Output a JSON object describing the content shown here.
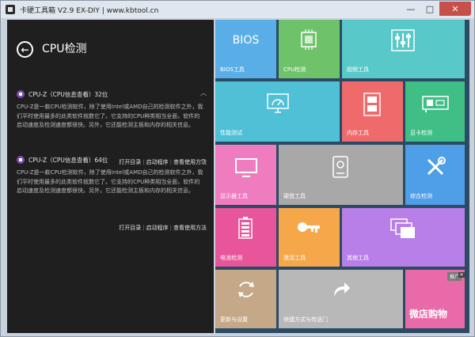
{
  "window": {
    "title": "卡硬工具箱 V2.9  EX-DIY  |  www.kbtool.cn",
    "controls": {
      "minimize": "—",
      "maximize": "□",
      "close": "✕"
    }
  },
  "left": {
    "back_icon": "arrow-left-icon",
    "page_title": "CPU检测",
    "items": [
      {
        "name": "CPU-Z（CPU信息查看）32位",
        "desc": "CPU-Z是一款CPU检测软件，除了使用Intel或AMD自己的检测软件之外，我们平时使用最多的此类软件就数它了。它支持的CPU种类相当全面，软件的启动速度及检测速度都很快。另外，它还能检测主板和内存的相关信息。",
        "links": [
          "打开目录",
          "启动程序",
          "查看使用方法"
        ]
      },
      {
        "name": "CPU-Z（CPU信息查看）64位",
        "desc": "CPU-Z是一款CPU检测软件，除了使用Intel或AMD自己的检测软件之外，我们平时使用最多的此类软件就数它了。它支持的CPU种类相当全面，软件的启动速度及检测速度都很快。另外，它还能检测主板和内存的相关信息。",
        "links": [
          "打开目录",
          "启动程序",
          "查看使用方法"
        ]
      }
    ]
  },
  "tiles": {
    "bios": {
      "label": "BIOS工具",
      "icon_text": "BIOS",
      "color": "#5aaee8"
    },
    "cpu": {
      "label": "CPU检测",
      "color": "#6ec36a"
    },
    "super": {
      "label": "超频工具",
      "color": "#58c8c8"
    },
    "perf": {
      "label": "性能测试",
      "color": "#4fc0d6"
    },
    "memory": {
      "label": "内存工具",
      "color": "#ef6b6b"
    },
    "gpu": {
      "label": "显卡检测",
      "color": "#3fbf86"
    },
    "display": {
      "label": "显示器工具",
      "color": "#f07cc0"
    },
    "disk": {
      "label": "硬盘工具",
      "color": "#a8a8a8"
    },
    "diag": {
      "label": "综合检测",
      "color": "#4e9ee8"
    },
    "battery": {
      "label": "电池检测",
      "color": "#e8559a"
    },
    "activate": {
      "label": "激活工具",
      "color": "#f5a74a"
    },
    "other": {
      "label": "其他工具",
      "color": "#b97fe8"
    },
    "update": {
      "label": "更新与设置",
      "color": "#c4a888"
    },
    "shortcut": {
      "label": "快捷方式与传送门",
      "color": "#b8b8b8"
    },
    "ad": {
      "badge": "推广",
      "close": "✕",
      "text": "微店购物",
      "color": "#e86aa8"
    }
  }
}
